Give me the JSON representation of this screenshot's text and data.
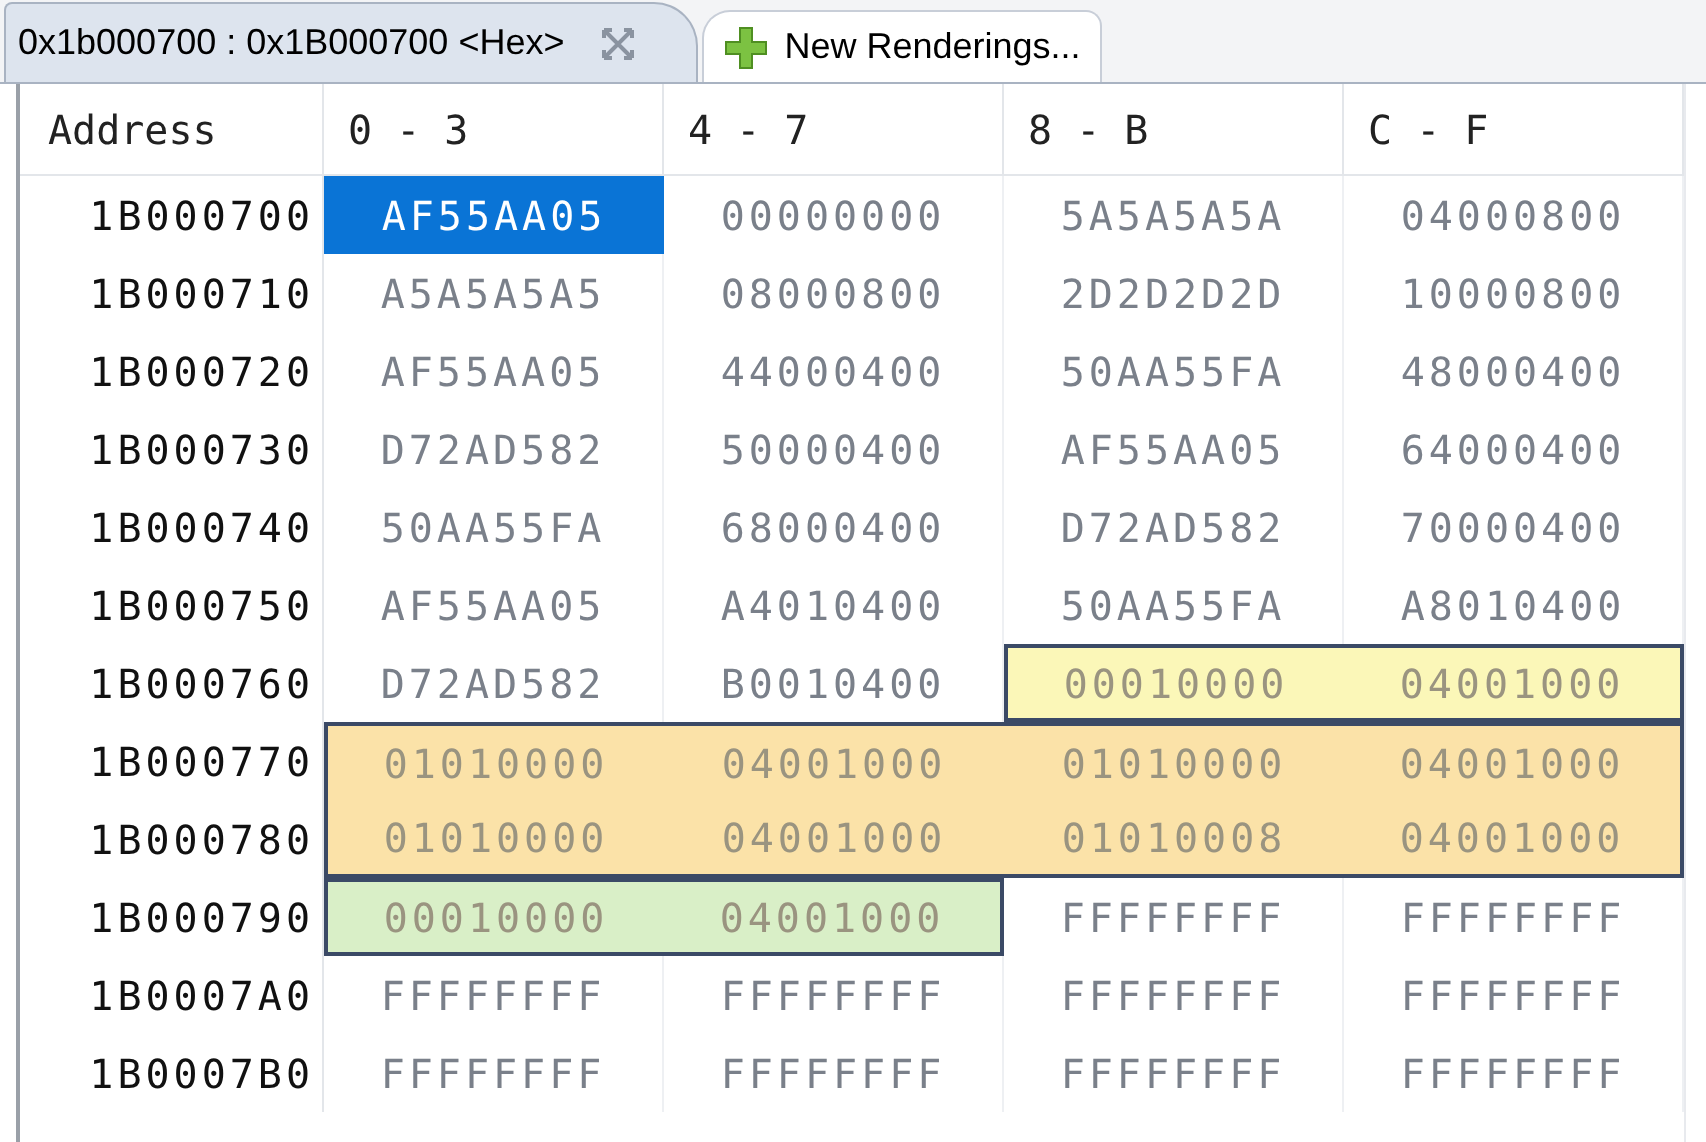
{
  "tabs": [
    {
      "label": "0x1b000700 : 0x1B000700 <Hex>",
      "kind": "rendering",
      "selected": true,
      "closable": true
    },
    {
      "label": "New Renderings...",
      "kind": "add",
      "selected": false,
      "closable": false
    }
  ],
  "table": {
    "columns": [
      "Address",
      "0 - 3",
      "4 - 7",
      "8 - B",
      "C - F"
    ],
    "rows": [
      {
        "cells": [
          {
            "value": "1B000700"
          },
          {
            "value": "AF55AA05",
            "selected": true
          },
          {
            "value": "00000000",
            "selected": false
          },
          {
            "value": "5A5A5A5A",
            "selected": false
          },
          {
            "value": "04000800",
            "selected": false
          }
        ]
      },
      {
        "cells": [
          {
            "value": "1B000710"
          },
          {
            "value": "A5A5A5A5",
            "selected": false
          },
          {
            "value": "08000800",
            "selected": false
          },
          {
            "value": "2D2D2D2D",
            "selected": false
          },
          {
            "value": "10000800",
            "selected": false
          }
        ]
      },
      {
        "cells": [
          {
            "value": "1B000720"
          },
          {
            "value": "AF55AA05",
            "selected": false
          },
          {
            "value": "44000400",
            "selected": false
          },
          {
            "value": "50AA55FA",
            "selected": false
          },
          {
            "value": "48000400",
            "selected": false
          }
        ]
      },
      {
        "cells": [
          {
            "value": "1B000730"
          },
          {
            "value": "D72AD582",
            "selected": false
          },
          {
            "value": "50000400",
            "selected": false
          },
          {
            "value": "AF55AA05",
            "selected": false
          },
          {
            "value": "64000400",
            "selected": false
          }
        ]
      },
      {
        "cells": [
          {
            "value": "1B000740"
          },
          {
            "value": "50AA55FA",
            "selected": false
          },
          {
            "value": "68000400",
            "selected": false
          },
          {
            "value": "D72AD582",
            "selected": false
          },
          {
            "value": "70000400",
            "selected": false
          }
        ]
      },
      {
        "cells": [
          {
            "value": "1B000750"
          },
          {
            "value": "AF55AA05",
            "selected": false
          },
          {
            "value": "A4010400",
            "selected": false
          },
          {
            "value": "50AA55FA",
            "selected": false
          },
          {
            "value": "A8010400",
            "selected": false
          }
        ]
      },
      {
        "cells": [
          {
            "value": "1B000760"
          },
          {
            "value": "D72AD582",
            "selected": false
          },
          {
            "value": "B0010400",
            "selected": false
          },
          {
            "value": "00010000",
            "selected": false,
            "color": "#fbf7b8"
          },
          {
            "value": "04001000",
            "selected": false,
            "color": "#fbf7b8"
          }
        ]
      },
      {
        "cells": [
          {
            "value": "1B000770"
          },
          {
            "value": "01010000",
            "selected": false,
            "color": "#fbe2a8"
          },
          {
            "value": "04001000",
            "selected": false,
            "color": "#fbe2a8"
          },
          {
            "value": "01010000",
            "selected": false,
            "color": "#fbe2a8"
          },
          {
            "value": "04001000",
            "selected": false,
            "color": "#fbe2a8"
          }
        ]
      },
      {
        "cells": [
          {
            "value": "1B000780"
          },
          {
            "value": "01010000",
            "selected": false,
            "color": "#fbe2a8"
          },
          {
            "value": "04001000",
            "selected": false,
            "color": "#fbe2a8"
          },
          {
            "value": "01010008",
            "selected": false,
            "color": "#fbe2a8"
          },
          {
            "value": "04001000",
            "selected": false,
            "color": "#fbe2a8"
          }
        ]
      },
      {
        "cells": [
          {
            "value": "1B000790"
          },
          {
            "value": "00010000",
            "selected": false,
            "color": "#d9efc7"
          },
          {
            "value": "04001000",
            "selected": false,
            "color": "#d9efc7"
          },
          {
            "value": "FFFFFFFF",
            "selected": false
          },
          {
            "value": "FFFFFFFF",
            "selected": false
          }
        ]
      },
      {
        "cells": [
          {
            "value": "1B0007A0"
          },
          {
            "value": "FFFFFFFF",
            "selected": false
          },
          {
            "value": "FFFFFFFF",
            "selected": false
          },
          {
            "value": "FFFFFFFF",
            "selected": false
          },
          {
            "value": "FFFFFFFF",
            "selected": false
          }
        ]
      },
      {
        "cells": [
          {
            "value": "1B0007B0"
          },
          {
            "value": "FFFFFFFF",
            "selected": false
          },
          {
            "value": "FFFFFFFF",
            "selected": false
          },
          {
            "value": "FFFFFFFF",
            "selected": false
          },
          {
            "value": "FFFFFFFF",
            "selected": false
          }
        ]
      }
    ]
  }
}
